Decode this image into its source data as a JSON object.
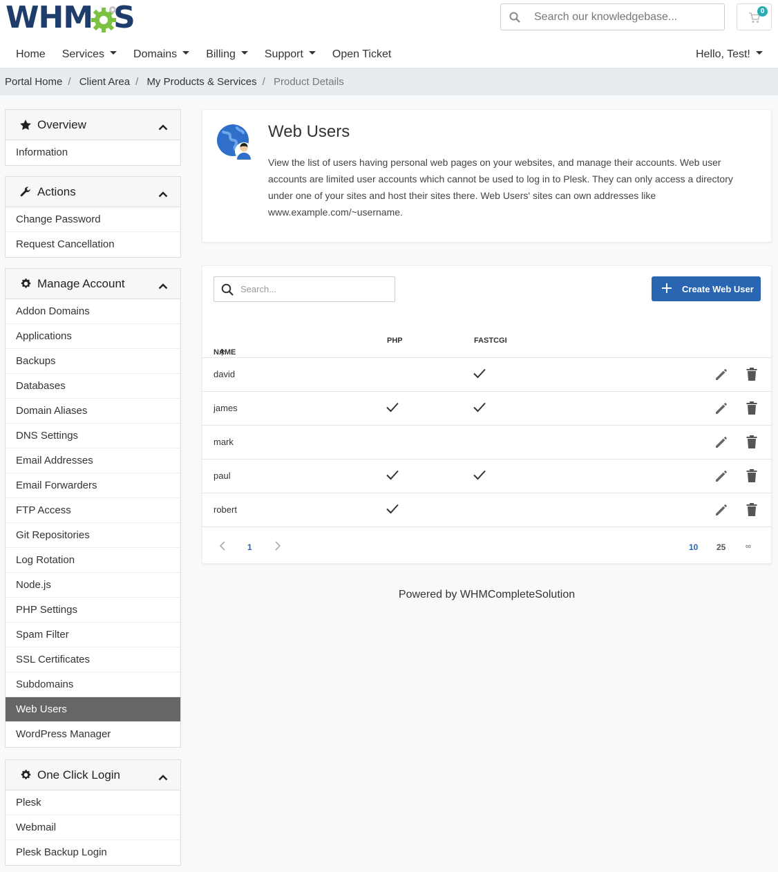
{
  "brand": {
    "logo_text_left": "WHM",
    "logo_text_right": "S"
  },
  "header": {
    "search_placeholder": "Search our knowledgebase...",
    "cart_count": "0",
    "nav": [
      {
        "label": "Home",
        "dropdown": false
      },
      {
        "label": "Services",
        "dropdown": true
      },
      {
        "label": "Domains",
        "dropdown": true
      },
      {
        "label": "Billing",
        "dropdown": true
      },
      {
        "label": "Support",
        "dropdown": true
      },
      {
        "label": "Open Ticket",
        "dropdown": false
      }
    ],
    "account_label": "Hello, Test!"
  },
  "breadcrumb": [
    "Portal Home",
    "Client Area",
    "My Products & Services",
    "Product Details"
  ],
  "sidebar": {
    "overview": {
      "title": "Overview",
      "items": [
        "Information"
      ]
    },
    "actions": {
      "title": "Actions",
      "items": [
        "Change Password",
        "Request Cancellation"
      ]
    },
    "manage": {
      "title": "Manage Account",
      "items": [
        "Addon Domains",
        "Applications",
        "Backups",
        "Databases",
        "Domain Aliases",
        "DNS Settings",
        "Email Addresses",
        "Email Forwarders",
        "FTP Access",
        "Git Repositories",
        "Log Rotation",
        "Node.js",
        "PHP Settings",
        "Spam Filter",
        "SSL Certificates",
        "Subdomains",
        "Web Users",
        "WordPress Manager"
      ],
      "active": "Web Users"
    },
    "oneclick": {
      "title": "One Click Login",
      "items": [
        "Plesk",
        "Webmail",
        "Plesk Backup Login"
      ]
    }
  },
  "intro": {
    "title": "Web Users",
    "text": "View the list of users having personal web pages on your websites, and manage their accounts. Web user accounts are limited user accounts which cannot be used to log in to Plesk. They can only access a directory under one of your sites and host their sites there. Web Users' sites can own addresses like www.example.com/~username."
  },
  "table": {
    "search_placeholder": "Search...",
    "create_button": "Create Web User",
    "columns": {
      "name": "NAME",
      "php": "PHP",
      "fastcgi": "FASTCGI"
    },
    "rows": [
      {
        "name": "david",
        "php": false,
        "fastcgi": true
      },
      {
        "name": "james",
        "php": true,
        "fastcgi": true
      },
      {
        "name": "mark",
        "php": false,
        "fastcgi": false
      },
      {
        "name": "paul",
        "php": true,
        "fastcgi": true
      },
      {
        "name": "robert",
        "php": true,
        "fastcgi": false
      }
    ],
    "pagination": {
      "current_page": "1",
      "page_sizes": [
        "10",
        "25",
        "∞"
      ],
      "active_size": "10"
    }
  },
  "footer": {
    "text": "Powered by WHMCompleteSolution"
  },
  "colors": {
    "primary": "#2a65b1",
    "cart_badge": "#27aeb2",
    "active_item": "#666666",
    "logo_navy": "#1f3d6b",
    "logo_green": "#7cc242"
  }
}
